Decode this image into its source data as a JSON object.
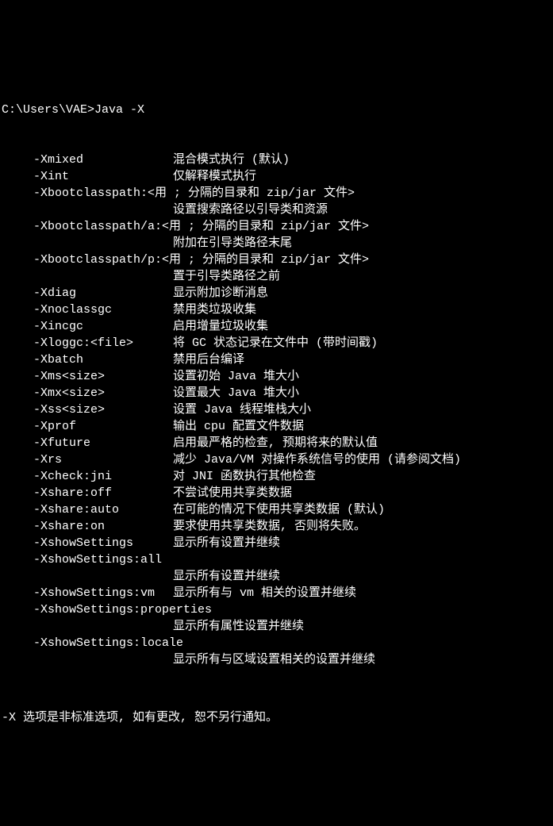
{
  "prompt": "C:\\Users\\VAE>Java -X",
  "options": [
    {
      "name": "-Xmixed",
      "desc": "混合模式执行 (默认)"
    },
    {
      "name": "-Xint",
      "desc": "仅解释模式执行"
    },
    {
      "name": "-Xbootclasspath:<用 ; 分隔的目录和 zip/jar 文件>",
      "wrap": true,
      "wrap_desc": "设置搜索路径以引导类和资源"
    },
    {
      "name": "-Xbootclasspath/a:<用 ; 分隔的目录和 zip/jar 文件>",
      "wrap": true,
      "wrap_desc": "附加在引导类路径末尾"
    },
    {
      "name": "-Xbootclasspath/p:<用 ; 分隔的目录和 zip/jar 文件>",
      "wrap": true,
      "wrap_desc": "置于引导类路径之前"
    },
    {
      "name": "-Xdiag",
      "desc": "显示附加诊断消息"
    },
    {
      "name": "-Xnoclassgc",
      "desc": "禁用类垃圾收集"
    },
    {
      "name": "-Xincgc",
      "desc": "启用增量垃圾收集"
    },
    {
      "name": "-Xloggc:<file>",
      "desc": "将 GC 状态记录在文件中 (带时间戳)"
    },
    {
      "name": "-Xbatch",
      "desc": "禁用后台编译"
    },
    {
      "name": "-Xms<size>",
      "desc": "设置初始 Java 堆大小"
    },
    {
      "name": "-Xmx<size>",
      "desc": "设置最大 Java 堆大小"
    },
    {
      "name": "-Xss<size>",
      "desc": "设置 Java 线程堆栈大小"
    },
    {
      "name": "-Xprof",
      "desc": "输出 cpu 配置文件数据"
    },
    {
      "name": "-Xfuture",
      "desc": "启用最严格的检查, 预期将来的默认值"
    },
    {
      "name": "-Xrs",
      "desc": "减少 Java/VM 对操作系统信号的使用 (请参阅文档)"
    },
    {
      "name": "-Xcheck:jni",
      "desc": "对 JNI 函数执行其他检查"
    },
    {
      "name": "-Xshare:off",
      "desc": "不尝试使用共享类数据"
    },
    {
      "name": "-Xshare:auto",
      "desc": "在可能的情况下使用共享类数据 (默认)"
    },
    {
      "name": "-Xshare:on",
      "desc": "要求使用共享类数据, 否则将失败。"
    },
    {
      "name": "-XshowSettings",
      "desc": "显示所有设置并继续"
    },
    {
      "name": "-XshowSettings:all",
      "wrap": true,
      "wrap_desc": "显示所有设置并继续"
    },
    {
      "name": "-XshowSettings:vm",
      "desc": "显示所有与 vm 相关的设置并继续"
    },
    {
      "name": "-XshowSettings:properties",
      "wrap": true,
      "wrap_desc": "显示所有属性设置并继续"
    },
    {
      "name": "-XshowSettings:locale",
      "wrap": true,
      "wrap_desc": "显示所有与区域设置相关的设置并继续"
    }
  ],
  "footer": "-X 选项是非标准选项, 如有更改, 恕不另行通知。"
}
